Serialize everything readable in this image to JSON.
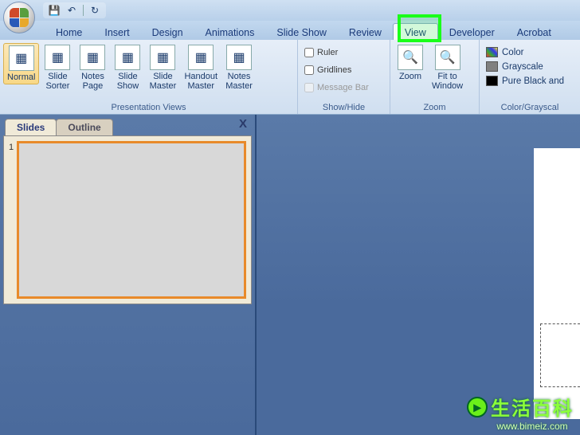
{
  "qat": {
    "save": "💾",
    "undo": "↶",
    "redo": "↻"
  },
  "menu": {
    "tabs": [
      "Home",
      "Insert",
      "Design",
      "Animations",
      "Slide Show",
      "Review",
      "View",
      "Developer",
      "Acrobat"
    ],
    "active_index": 6
  },
  "ribbon": {
    "groups": {
      "presentation_views": {
        "label": "Presentation Views",
        "buttons": [
          {
            "name": "normal",
            "label": "Normal",
            "selected": true
          },
          {
            "name": "slide-sorter",
            "label": "Slide\nSorter"
          },
          {
            "name": "notes-page",
            "label": "Notes\nPage"
          },
          {
            "name": "slide-show",
            "label": "Slide\nShow"
          },
          {
            "name": "slide-master",
            "label": "Slide\nMaster"
          },
          {
            "name": "handout-master",
            "label": "Handout\nMaster"
          },
          {
            "name": "notes-master",
            "label": "Notes\nMaster"
          }
        ]
      },
      "show_hide": {
        "label": "Show/Hide",
        "items": [
          {
            "name": "ruler",
            "label": "Ruler",
            "checked": false,
            "enabled": true
          },
          {
            "name": "gridlines",
            "label": "Gridlines",
            "checked": false,
            "enabled": true
          },
          {
            "name": "message-bar",
            "label": "Message Bar",
            "checked": false,
            "enabled": false
          }
        ]
      },
      "zoom": {
        "label": "Zoom",
        "buttons": [
          {
            "name": "zoom",
            "label": "Zoom"
          },
          {
            "name": "fit-to-window",
            "label": "Fit to\nWindow"
          }
        ]
      },
      "color_grayscale": {
        "label": "Color/Grayscal",
        "items": [
          {
            "name": "color",
            "label": "Color",
            "swatch": "multi"
          },
          {
            "name": "grayscale",
            "label": "Grayscale",
            "swatch": "#808080"
          },
          {
            "name": "pure-bw",
            "label": "Pure Black and",
            "swatch": "#000"
          }
        ]
      }
    }
  },
  "pane": {
    "tabs": [
      "Slides",
      "Outline"
    ],
    "active_index": 0,
    "close_glyph": "X",
    "thumb_number": "1"
  },
  "watermark": {
    "cn": "生活百科",
    "url": "www.bimeiz.com",
    "arrow": "▸"
  }
}
